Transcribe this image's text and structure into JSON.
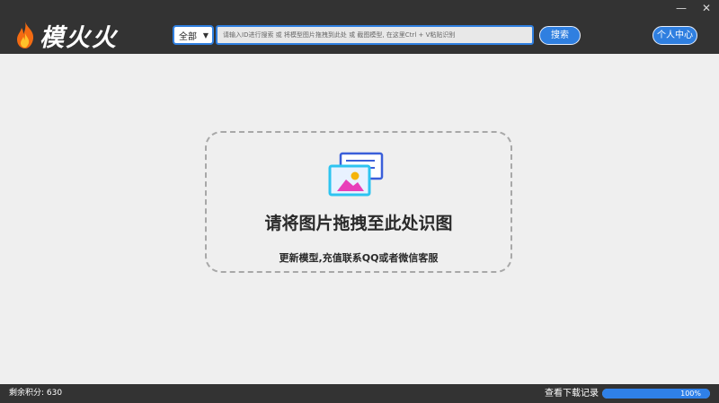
{
  "window": {
    "minimize_glyph": "—",
    "close_glyph": "✕"
  },
  "header": {
    "logo_text": "模火火",
    "logo_icon": "flame-icon",
    "category_select": {
      "value": "全部"
    },
    "search": {
      "placeholder": "请输入ID进行搜索 或 将模型图片拖拽到此处 或 截图模型, 在这里Ctrl + V粘贴识别"
    },
    "search_button": "搜索",
    "user_button": "个人中心"
  },
  "dropzone": {
    "icon": "image-upload-icon",
    "title": "请将图片拖拽至此处识图",
    "subtitle": "更新模型,充值联系QQ或者微信客服"
  },
  "status": {
    "credits": "剩余积分: 630",
    "records_link": "查看下载记录",
    "progress_value": 100,
    "progress_label": "100%"
  },
  "colors": {
    "accent": "#2f7fe0",
    "bar_bg": "#333333",
    "page_bg": "#efefef"
  }
}
